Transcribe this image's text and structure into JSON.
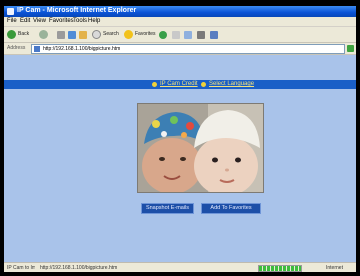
{
  "window": {
    "title": "IP Cam - Microsoft Internet Explorer"
  },
  "menu": [
    "File",
    "Edit",
    "View",
    "Favorites",
    "Tools",
    "Help"
  ],
  "toolbar": {
    "back_label": "Back",
    "search_label": "Search",
    "favorites_label": "Favorites"
  },
  "address": {
    "label": "Address",
    "value": "http://192.168.1.100/bigpicture.htm"
  },
  "page": {
    "nav_link_1": "IP Cam Credit",
    "nav_link_2": "Select Language",
    "button_1": "Snapshot E-mails",
    "button_2": "Add To Favorites"
  },
  "status": {
    "left": "IP Cam to Image",
    "middle": "http://192.168.1.100/bigpicture.htm",
    "right": "Internet"
  },
  "colors": {
    "titlebar": "#0a52d6",
    "content_bg": "#a9c3ea",
    "nav_band": "#1a5fc7",
    "button_bg": "#1d4fa8"
  }
}
